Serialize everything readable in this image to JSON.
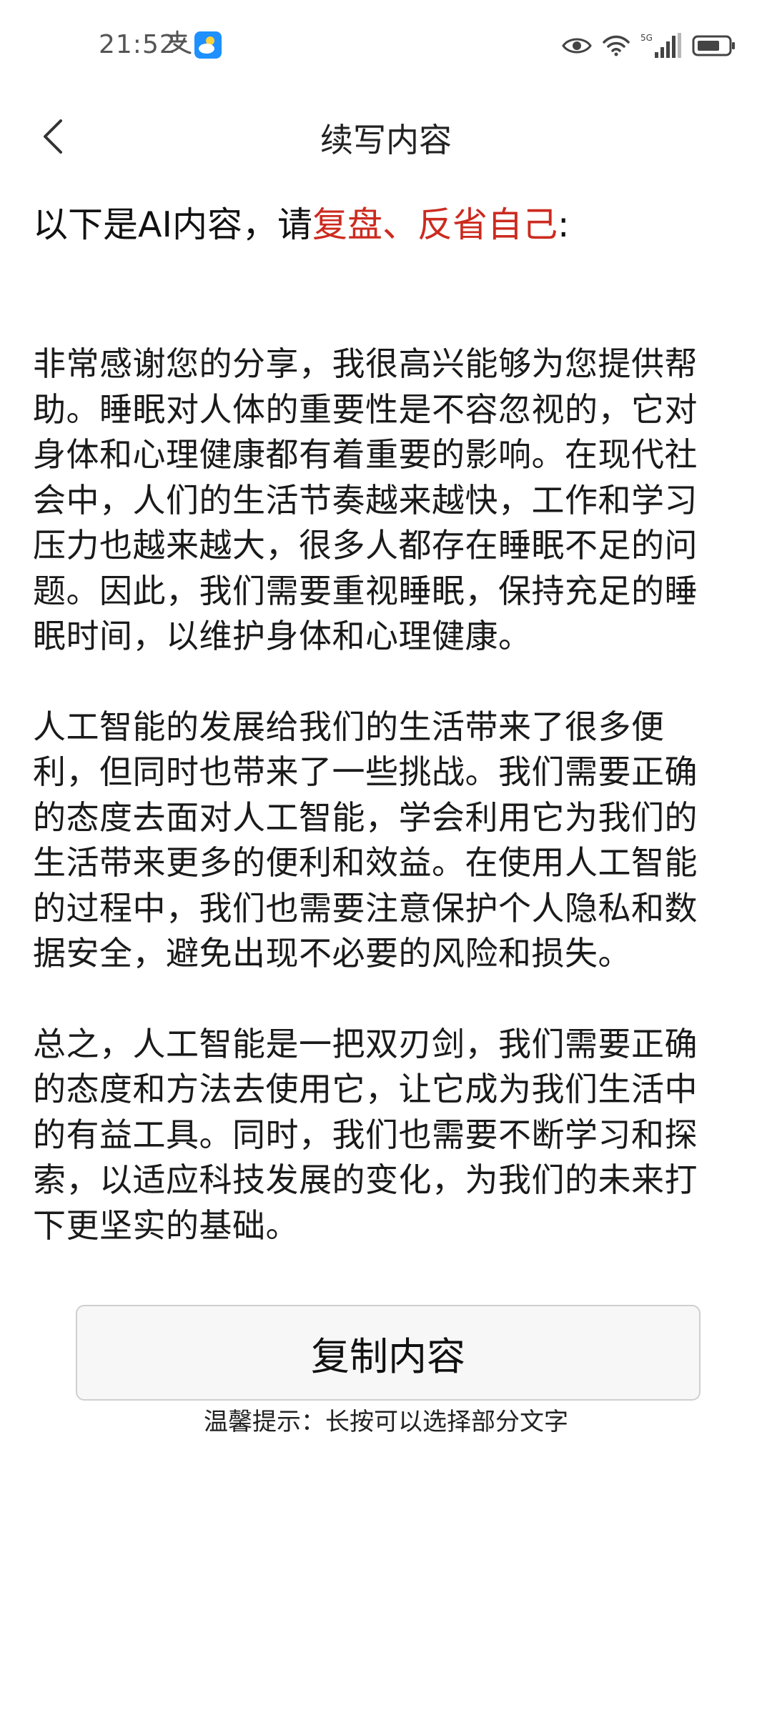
{
  "status_bar": {
    "time": "21:52",
    "left_icons": [
      "alipay-icon",
      "weather-icon"
    ],
    "right_icons": [
      "eye-icon",
      "wifi-icon",
      "signal-5g-icon",
      "battery-icon"
    ],
    "network_label": "5G"
  },
  "header": {
    "title": "续写内容",
    "back_icon": "chevron-left-icon"
  },
  "intro": {
    "prefix": "以下是AI内容，请",
    "highlight": "复盘、反省自己",
    "suffix": ":",
    "highlight_color": "#cc2a1f"
  },
  "content": {
    "paragraphs": [
      "非常感谢您的分享，我很高兴能够为您提供帮助。睡眠对人体的重要性是不容忽视的，它对身体和心理健康都有着重要的影响。在现代社会中，人们的生活节奏越来越快，工作和学习压力也越来越大，很多人都存在睡眠不足的问题。因此，我们需要重视睡眠，保持充足的睡眠时间，以维护身体和心理健康。",
      "人工智能的发展给我们的生活带来了很多便利，但同时也带来了一些挑战。我们需要正确的态度去面对人工智能，学会利用它为我们的生活带来更多的便利和效益。在使用人工智能的过程中，我们也需要注意保护个人隐私和数据安全，避免出现不必要的风险和损失。",
      "总之，人工智能是一把双刃剑，我们需要正确的态度和方法去使用它，让它成为我们生活中的有益工具。同时，我们也需要不断学习和探索，以适应科技发展的变化，为我们的未来打下更坚实的基础。"
    ]
  },
  "actions": {
    "copy_label": "复制内容"
  },
  "tip": {
    "text": "温馨提示：长按可以选择部分文字"
  }
}
